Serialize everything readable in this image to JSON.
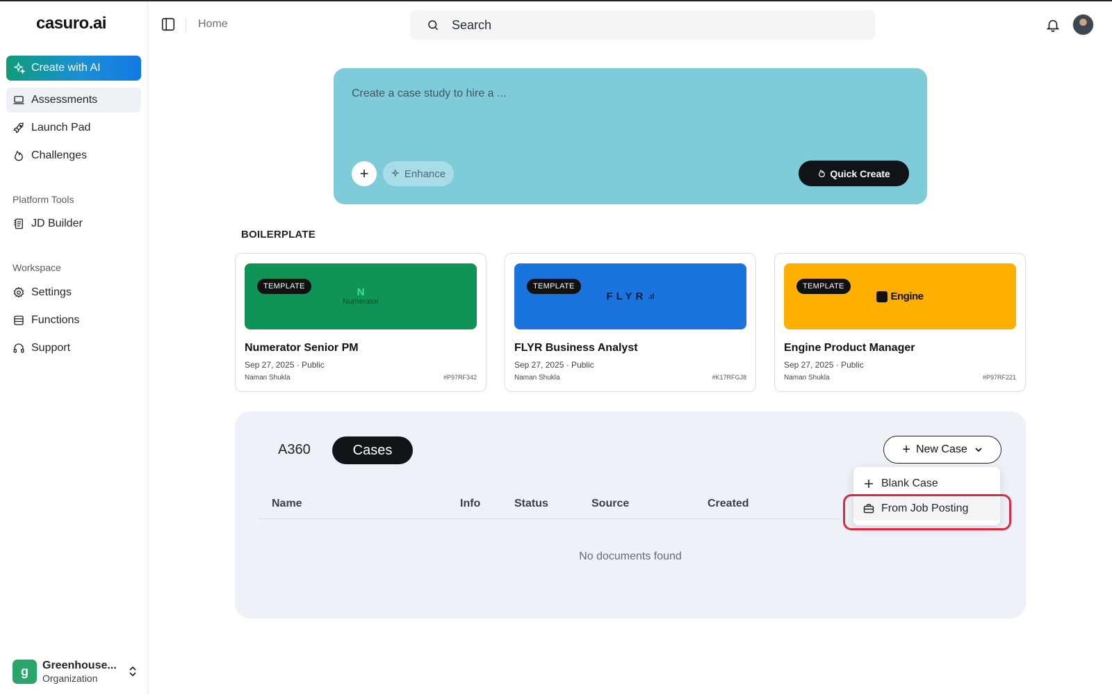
{
  "app": {
    "logo": "casuro.ai"
  },
  "sidebar": {
    "create_button": "Create with AI",
    "items": [
      {
        "label": "Assessments",
        "icon": "laptop-icon",
        "active": true
      },
      {
        "label": "Launch Pad",
        "icon": "rocket-icon"
      },
      {
        "label": "Challenges",
        "icon": "flame-icon"
      }
    ],
    "section_platform": "Platform Tools",
    "platform_items": [
      {
        "label": "JD Builder",
        "icon": "document-builder-icon"
      }
    ],
    "section_workspace": "Workspace",
    "workspace_items": [
      {
        "label": "Settings",
        "icon": "gear-icon"
      },
      {
        "label": "Functions",
        "icon": "list-icon"
      },
      {
        "label": "Support",
        "icon": "headset-icon"
      }
    ],
    "org": {
      "badge": "g",
      "name": "Greenhouse...",
      "type": "Organization"
    }
  },
  "header": {
    "breadcrumb": "Home",
    "search_placeholder": "Search"
  },
  "hero": {
    "placeholder": "Create a case study to hire a ...",
    "enhance_label": "Enhance",
    "quick_create_label": "Quick Create"
  },
  "boilerplate": {
    "title": "BOILERPLATE",
    "cards": [
      {
        "badge": "TEMPLATE",
        "brand": "Numerator",
        "title": "Numerator Senior PM",
        "meta": "Sep 27, 2025 · Public",
        "author": "Naman Shukla",
        "id": "#P97RF342",
        "color": "#0f9356"
      },
      {
        "badge": "TEMPLATE",
        "brand": "FLYR",
        "title": "FLYR Business Analyst",
        "meta": "Sep 27, 2025 · Public",
        "author": "Naman Shukla",
        "id": "#K17RFGJ8",
        "color": "#1b74dd"
      },
      {
        "badge": "TEMPLATE",
        "brand": "Engine",
        "title": "Engine Product Manager",
        "meta": "Sep 27, 2025 · Public",
        "author": "Naman Shukla",
        "id": "#P97RF221",
        "color": "#fdb002"
      }
    ]
  },
  "cases": {
    "tab_a360": "A360",
    "tab_cases": "Cases",
    "new_case_label": "New Case",
    "columns": [
      "Name",
      "Info",
      "Status",
      "Source",
      "Created"
    ],
    "empty_text": "No documents found",
    "dropdown": [
      {
        "label": "Blank Case",
        "icon": "plus-icon"
      },
      {
        "label": "From Job Posting",
        "icon": "briefcase-icon"
      }
    ]
  }
}
